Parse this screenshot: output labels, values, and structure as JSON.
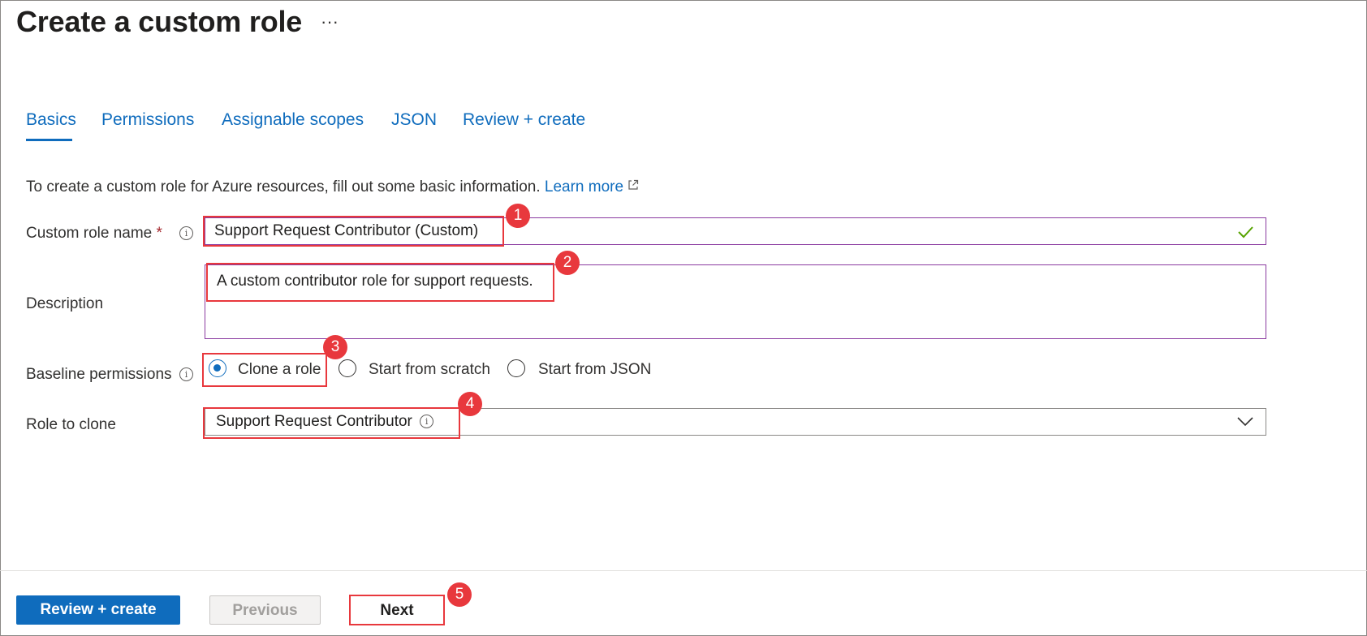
{
  "header": {
    "title": "Create a custom role",
    "more": "···"
  },
  "tabs": [
    {
      "label": "Basics",
      "active": true
    },
    {
      "label": "Permissions",
      "active": false
    },
    {
      "label": "Assignable scopes",
      "active": false
    },
    {
      "label": "JSON",
      "active": false
    },
    {
      "label": "Review + create",
      "active": false
    }
  ],
  "intro": {
    "text": "To create a custom role for Azure resources, fill out some basic information.",
    "link": "Learn more"
  },
  "form": {
    "role_name": {
      "label": "Custom role name",
      "required": "*",
      "value": "Support Request Contributor (Custom)",
      "valid": true
    },
    "description": {
      "label": "Description",
      "value": "A custom contributor role for support requests."
    },
    "baseline": {
      "label": "Baseline permissions",
      "options": [
        {
          "label": "Clone a role",
          "selected": true
        },
        {
          "label": "Start from scratch",
          "selected": false
        },
        {
          "label": "Start from JSON",
          "selected": false
        }
      ]
    },
    "role_to_clone": {
      "label": "Role to clone",
      "value": "Support Request Contributor"
    }
  },
  "footer": {
    "review_create": "Review + create",
    "previous": "Previous",
    "next": "Next"
  },
  "callouts": [
    "1",
    "2",
    "3",
    "4",
    "5"
  ],
  "colors": {
    "accent": "#0f6cbd",
    "callout": "#e8383d",
    "valid": "#57a300",
    "focus_border": "#8a3aa0"
  },
  "icons": [
    "more-icon",
    "info-icon",
    "external-link-icon",
    "checkmark-icon",
    "chevron-down-icon"
  ]
}
